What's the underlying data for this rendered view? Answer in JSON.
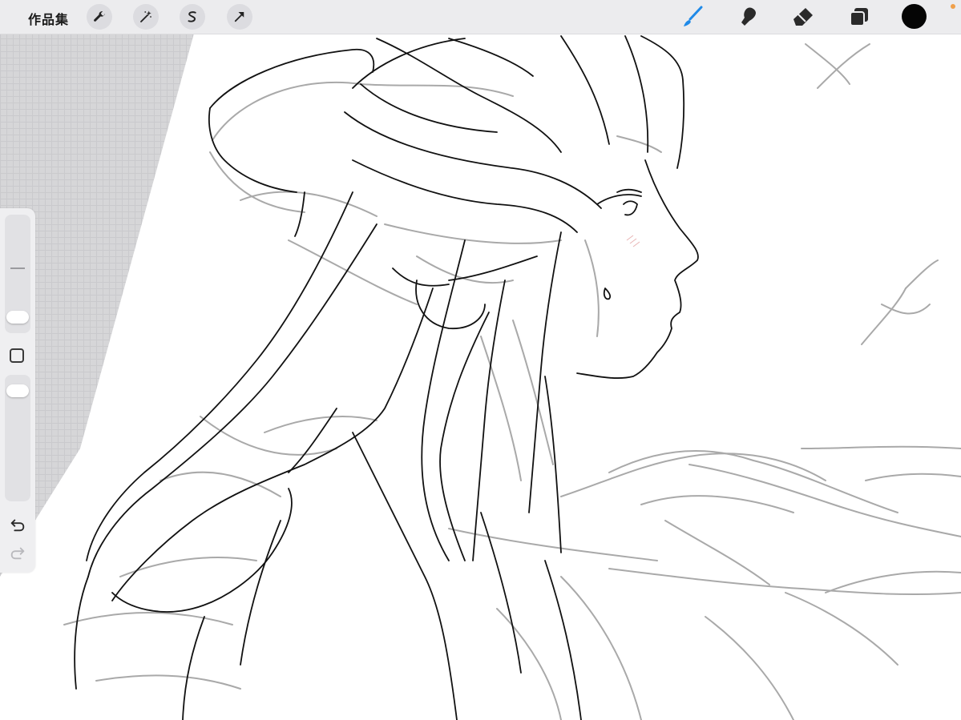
{
  "app": {
    "gallery_label": "作品集"
  },
  "toolbar": {
    "left_tools": [
      {
        "name": "actions",
        "icon": "wrench-icon"
      },
      {
        "name": "adjustments",
        "icon": "magic-wand-icon"
      },
      {
        "name": "selection",
        "icon": "selection-s-icon"
      },
      {
        "name": "transform",
        "icon": "arrow-cursor-icon"
      }
    ],
    "right_tools": [
      {
        "name": "brush",
        "icon": "brush-icon",
        "active": true
      },
      {
        "name": "smudge",
        "icon": "smudge-finger-icon",
        "active": false
      },
      {
        "name": "eraser",
        "icon": "eraser-icon",
        "active": false
      },
      {
        "name": "layers",
        "icon": "layers-icon",
        "active": false
      }
    ],
    "current_color": "#050505",
    "active_color": "#1f8ae8"
  },
  "sidebar": {
    "brush_size_slider": {
      "value": 0.3
    },
    "opacity_slider": {
      "value": 0.9
    },
    "undo_icon": "undo-arrow-icon",
    "redo_icon": "redo-arrow-icon"
  }
}
